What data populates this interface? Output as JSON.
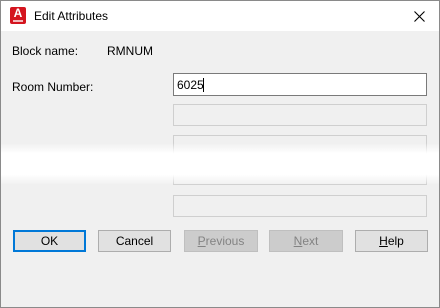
{
  "window": {
    "title": "Edit Attributes",
    "icon": "autocad-app-icon",
    "accent_color": "#d4151f"
  },
  "block": {
    "label": "Block name:",
    "value": "RMNUM"
  },
  "attribute": {
    "label": "Room Number:",
    "value": "6025"
  },
  "buttons": {
    "ok": "OK",
    "cancel": "Cancel",
    "previous_u": "P",
    "previous_rest": "revious",
    "next_u": "N",
    "next_rest": "ext",
    "help_u": "H",
    "help_rest": "elp"
  }
}
